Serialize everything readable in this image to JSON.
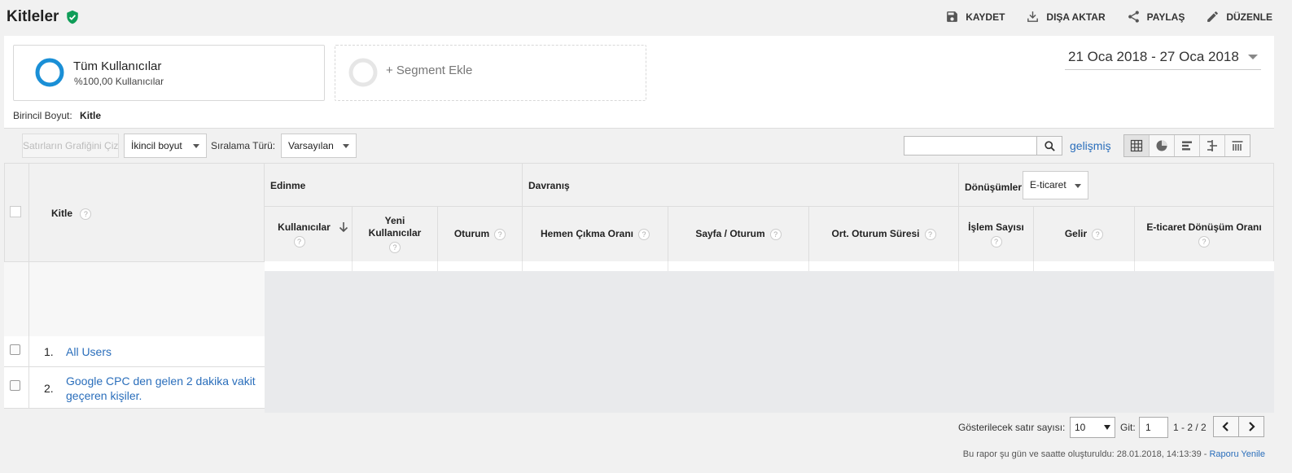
{
  "header": {
    "title": "Kitleler",
    "actions": [
      {
        "label": "KAYDET",
        "icon": "save-icon"
      },
      {
        "label": "DIŞA AKTAR",
        "icon": "download-icon"
      },
      {
        "label": "PAYLAŞ",
        "icon": "share-icon"
      },
      {
        "label": "DÜZENLE",
        "icon": "edit-icon"
      }
    ]
  },
  "segments": {
    "active": {
      "title": "Tüm Kullanıcılar",
      "subtitle": "%100,00 Kullanıcılar"
    },
    "add": {
      "label": "+ Segment Ekle"
    }
  },
  "date_range": "21 Oca 2018 - 27 Oca 2018",
  "primary_dimension": {
    "label": "Birincil Boyut:",
    "value": "Kitle"
  },
  "toolbar": {
    "plot_rows": "Satırların Grafiğini Çiz",
    "secondary_dimension": "İkincil boyut",
    "sort_label": "Sıralama Türü:",
    "sort_value": "Varsayılan",
    "search_placeholder": "",
    "advanced": "gelişmiş"
  },
  "table": {
    "dimension_header": "Kitle",
    "groups": {
      "acquisition": "Edinme",
      "behavior": "Davranış",
      "conversions": "Dönüşümler",
      "conversions_dropdown": "E-ticaret"
    },
    "columns": {
      "users": "Kullanıcılar",
      "new_users": "Yeni Kullanıcılar",
      "sessions": "Oturum",
      "bounce_rate": "Hemen Çıkma Oranı",
      "pages_per_session": "Sayfa / Oturum",
      "avg_session": "Ort. Oturum Süresi",
      "transactions": "İşlem Sayısı",
      "revenue": "Gelir",
      "ecommerce_rate": "E-ticaret Dönüşüm Oranı"
    },
    "rows": [
      {
        "index": "1.",
        "label": "All Users"
      },
      {
        "index": "2.",
        "label": "Google CPC den gelen 2 dakika vakit geçeren kişiler."
      }
    ]
  },
  "pagination": {
    "rows_label": "Gösterilecek satır sayısı:",
    "rows_value": "10",
    "goto_label": "Git:",
    "page": "1",
    "range": "1 - 2 / 2"
  },
  "footer": {
    "text": "Bu rapor şu gün ve saatte oluşturuldu: 28.01.2018, 14:13:39 -",
    "refresh": "Raporu Yenile"
  },
  "colors": {
    "accent": "#1a8fd6",
    "link": "#2a6ebb",
    "verified": "#0f9d58"
  }
}
